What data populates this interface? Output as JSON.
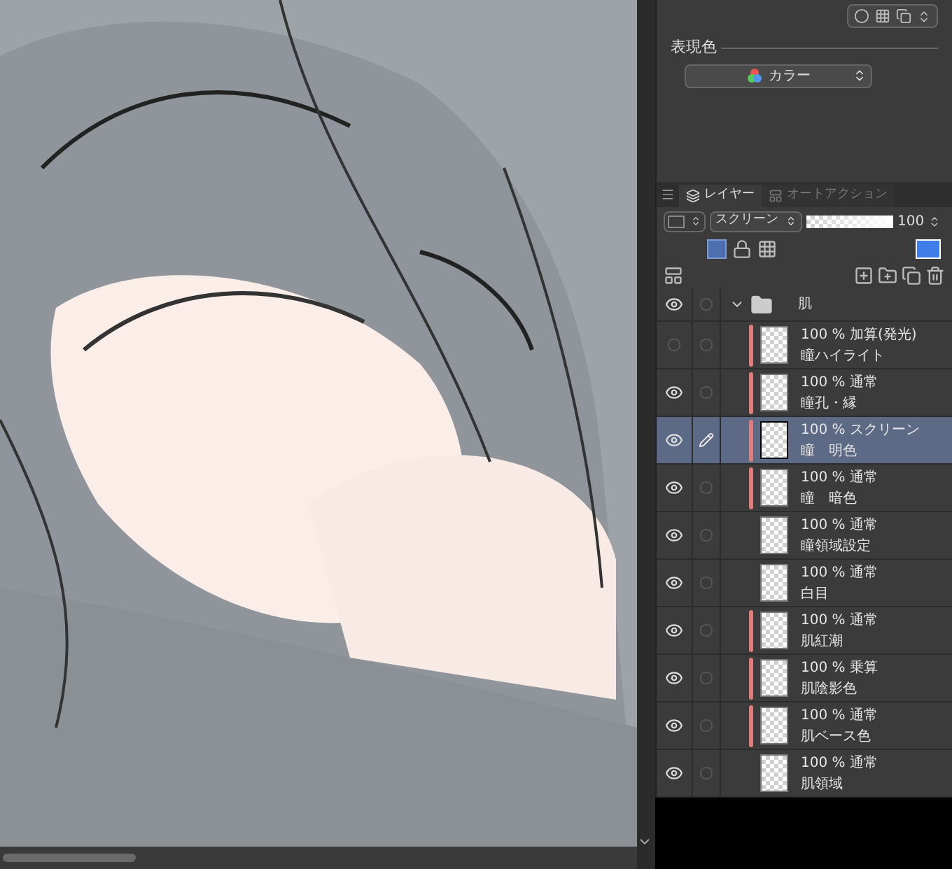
{
  "property_panel": {
    "color_label": "表現色",
    "color_mode": "カラー"
  },
  "layer_panel": {
    "tabs": [
      {
        "label": "レイヤー",
        "selected": true
      },
      {
        "label": "オートアクション",
        "selected": false
      }
    ],
    "blend_mode": "スクリーン",
    "opacity": {
      "level": 1,
      "reading": "100"
    },
    "folder": {
      "name": "肌",
      "expanded": true,
      "checked": false
    },
    "layers": [
      {
        "mode": "100 % 加算(発光)",
        "name": "瞳ハイライト",
        "checked": false,
        "visible": false,
        "clipped": true,
        "selected": false
      },
      {
        "mode": "100 % 通常",
        "name": "瞳孔・縁",
        "checked": false,
        "visible": true,
        "clipped": true,
        "selected": false
      },
      {
        "mode": "100 % スクリーン",
        "name": "瞳　明色",
        "visible": true,
        "clipped": true,
        "selected": true
      },
      {
        "mode": "100 % 通常",
        "name": "瞳　暗色",
        "checked": false,
        "visible": true,
        "clipped": true,
        "selected": false
      },
      {
        "mode": "100 % 通常",
        "name": "瞳領域設定",
        "checked": false,
        "visible": true,
        "clipped": false,
        "selected": false
      },
      {
        "mode": "100 % 通常",
        "name": "白目",
        "checked": false,
        "visible": true,
        "clipped": false,
        "selected": false
      },
      {
        "mode": "100 % 通常",
        "name": "肌紅潮",
        "checked": false,
        "visible": true,
        "clipped": true,
        "selected": false
      },
      {
        "mode": "100 % 乗算",
        "name": "肌陰影色",
        "checked": false,
        "visible": true,
        "clipped": true,
        "selected": false
      },
      {
        "mode": "100 % 通常",
        "name": "肌ベース色",
        "checked": false,
        "visible": true,
        "clipped": true,
        "selected": false
      },
      {
        "mode": "100 % 通常",
        "name": "肌領域",
        "checked": false,
        "visible": true,
        "clipped": false,
        "selected": false
      }
    ]
  }
}
